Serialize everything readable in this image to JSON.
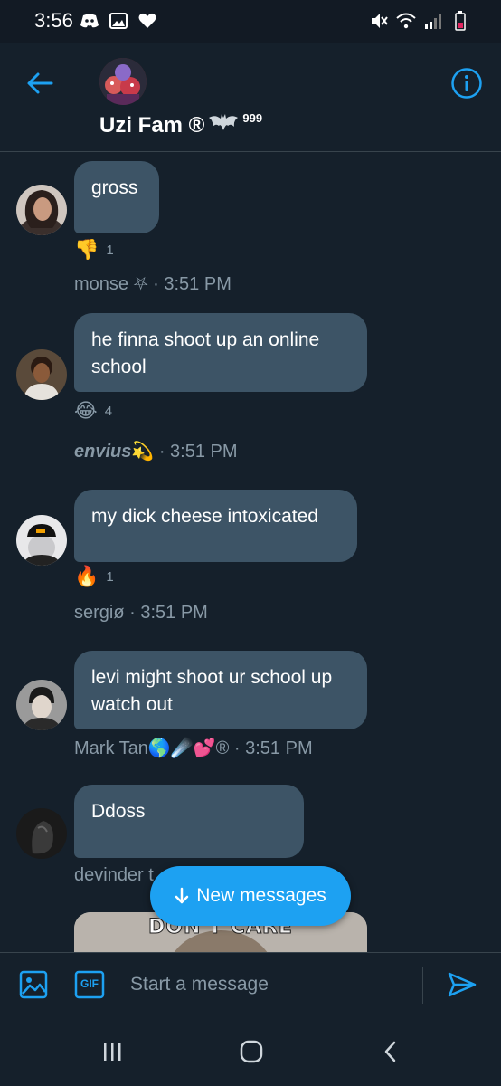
{
  "status_bar": {
    "time": "3:56",
    "left_icons": [
      "discord-icon",
      "image-icon",
      "heart-icon"
    ],
    "right_icons": [
      "mute-icon",
      "wifi-icon",
      "signal-icon",
      "battery-icon"
    ]
  },
  "header": {
    "group_name": "Uzi Fam ®",
    "group_name_badge": "999",
    "colors": {
      "accent": "#1da1f2",
      "background": "#15202b"
    }
  },
  "messages": [
    {
      "text": "gross",
      "reaction_emoji": "👎",
      "reaction_count": "1",
      "sender": "monse ⛧",
      "time": "· 3:51 PM"
    },
    {
      "text": "he finna shoot up an online school",
      "reaction_emoji": "😂",
      "reaction_count": "4",
      "sender": "envius",
      "sender_emoji": "💫",
      "time": "· 3:51 PM"
    },
    {
      "text": "my dick cheese intoxicated",
      "reaction_emoji": "🔥",
      "reaction_count": "1",
      "sender": "sergiø",
      "time": "· 3:51 PM"
    },
    {
      "text": "levi might shoot ur school up watch out",
      "sender": "Mark Tan",
      "sender_emoji": "🌎☄️💕®",
      "time": "· 3:51 PM"
    },
    {
      "text": "Ddoss",
      "sender": "devinder t"
    }
  ],
  "image_message": {
    "caption": "DON'T CARE"
  },
  "new_messages_button": {
    "label": "New messages"
  },
  "composer": {
    "placeholder": "Start a message",
    "gif_label": "GIF"
  }
}
